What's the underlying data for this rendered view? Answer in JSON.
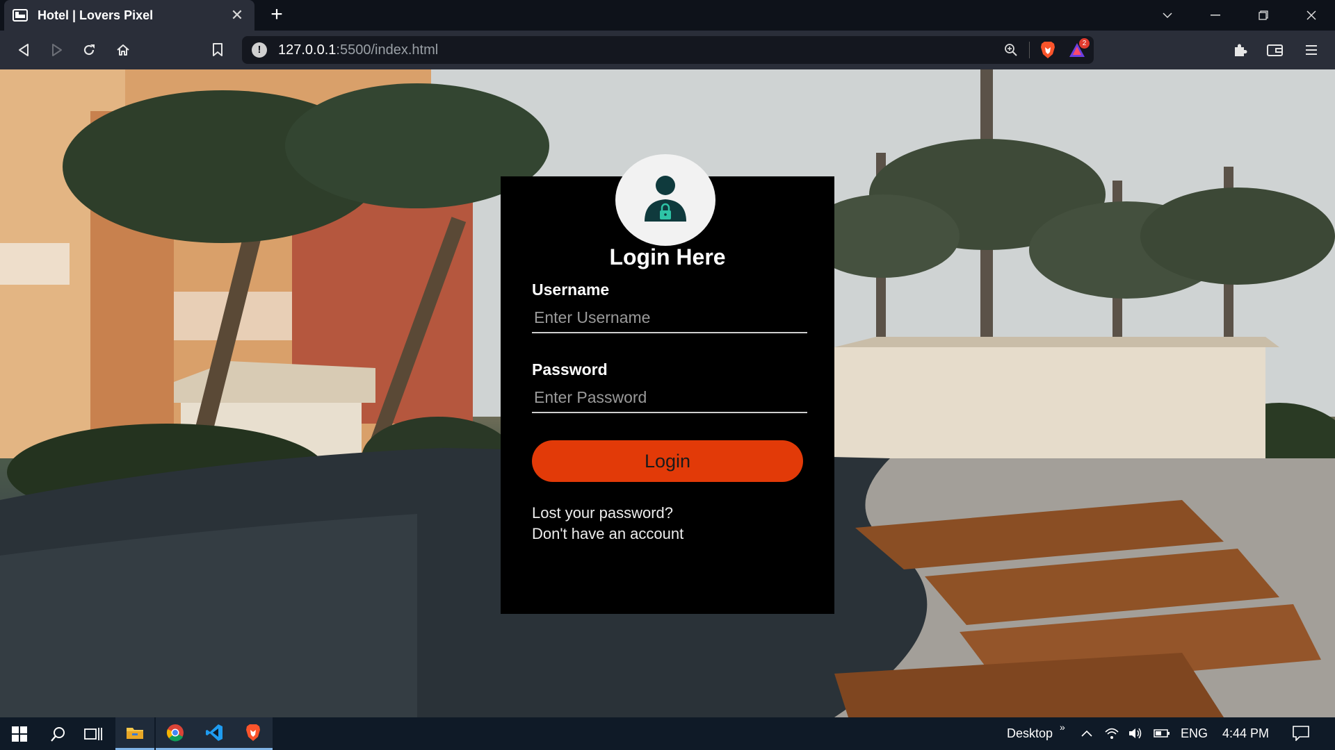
{
  "browser": {
    "tab": {
      "title": "Hotel | Lovers Pixel",
      "favicon": "hotel-bed-icon"
    },
    "address": {
      "host": "127.0.0.1",
      "path": ":5500/index.html"
    },
    "notification_count": "2",
    "icons": [
      "back-icon",
      "forward-icon",
      "reload-icon",
      "home-icon",
      "bookmark-icon",
      "zoom-icon",
      "brave-shield-icon",
      "brave-rewards-icon",
      "extensions-icon",
      "wallet-icon",
      "menu-icon"
    ]
  },
  "login": {
    "title": "Login Here",
    "username_label": "Username",
    "username_placeholder": "Enter Username",
    "password_label": "Password",
    "password_placeholder": "Enter Password",
    "button_label": "Login",
    "lost_password": "Lost your password?",
    "no_account": "Don't have an account",
    "avatar_icon": "user-lock-icon"
  },
  "taskbar": {
    "desktop_label": "Desktop",
    "language": "ENG",
    "time": "4:44 PM",
    "apps": [
      "windows-start-icon",
      "search-icon",
      "task-view-icon",
      "file-explorer-icon",
      "chrome-icon",
      "vscode-icon",
      "brave-icon"
    ]
  },
  "colors": {
    "accent": "#e23a08",
    "card": "#000000",
    "chrome": "#2a2e39",
    "taskbar": "#0f1a27"
  }
}
